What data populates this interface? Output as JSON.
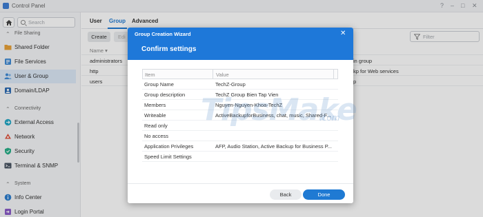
{
  "window": {
    "title": "Control Panel",
    "controls": [
      "?",
      "–",
      "□",
      "✕"
    ]
  },
  "sidebar": {
    "search_placeholder": "Search",
    "sections": [
      {
        "label": "File Sharing",
        "items": [
          {
            "label": "Shared Folder",
            "icon": "shared-folder-icon",
            "color": "#e8a23a"
          },
          {
            "label": "File Services",
            "icon": "file-services-icon",
            "color": "#3f8bd6"
          },
          {
            "label": "User & Group",
            "icon": "user-group-icon",
            "color": "#3f8bd6",
            "active": true
          },
          {
            "label": "Domain/LDAP",
            "icon": "domain-ldap-icon",
            "color": "#2f6db5"
          }
        ]
      },
      {
        "label": "Connectivity",
        "items": [
          {
            "label": "External Access",
            "icon": "external-access-icon",
            "color": "#27a9c7"
          },
          {
            "label": "Network",
            "icon": "network-icon",
            "color": "#e0543f"
          },
          {
            "label": "Security",
            "icon": "security-icon",
            "color": "#2ab08a"
          },
          {
            "label": "Terminal & SNMP",
            "icon": "terminal-icon",
            "color": "#4a5563"
          }
        ]
      },
      {
        "label": "System",
        "items": [
          {
            "label": "Info Center",
            "icon": "info-center-icon",
            "color": "#2f7fd0"
          },
          {
            "label": "Login Portal",
            "icon": "login-portal-icon",
            "color": "#8b5cc9"
          }
        ]
      }
    ]
  },
  "main": {
    "tabs": [
      "User",
      "Group",
      "Advanced"
    ],
    "active_tab": "Group",
    "toolbar": {
      "create_label": "Create",
      "edit_label": "Edi"
    },
    "filter_placeholder": "Filter",
    "column_name": "Name ▾",
    "rows": [
      {
        "name": "administrators",
        "description": "in group"
      },
      {
        "name": "http",
        "description": "kp for Web services"
      },
      {
        "name": "users",
        "description": "p"
      }
    ]
  },
  "dialog": {
    "window_title": "Group Creation Wizard",
    "step_title": "Confirm settings",
    "columns": [
      "Item",
      "Value"
    ],
    "rows": [
      {
        "item": "Group Name",
        "value": "TechZ-Group"
      },
      {
        "item": "Group description",
        "value": "TechZ Group Bien Tap Vien"
      },
      {
        "item": "Members",
        "value": "Nguyen-Nguyen-Khoa-TechZ"
      },
      {
        "item": "Writeable",
        "value": "ActiveBackupforBusiness, chat, music, Shared-F..."
      },
      {
        "item": "Read only",
        "value": ""
      },
      {
        "item": "No access",
        "value": ""
      },
      {
        "item": "Application Privileges",
        "value": "AFP, Audio Station, Active Backup for Business P..."
      },
      {
        "item": "Speed Limit Settings",
        "value": ""
      }
    ],
    "back_label": "Back",
    "done_label": "Done"
  },
  "watermark": {
    "text": "TipsMake",
    "suffix": ".com"
  },
  "colors": {
    "accent": "#1f7ad3",
    "dialog_header": "#1e78d9",
    "active_nav_bg": "#dde9f7"
  }
}
